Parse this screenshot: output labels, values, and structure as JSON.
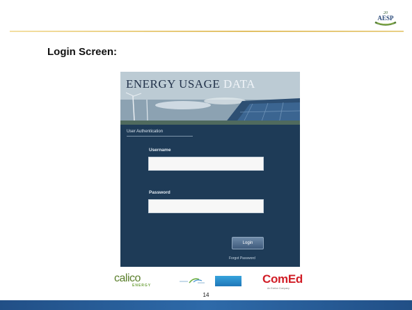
{
  "slide": {
    "title": "Login Screen:",
    "page_number": "14",
    "brand_logo_text": "AESP",
    "brand_logo_icon": "aesp-logo-icon"
  },
  "login_panel": {
    "banner": {
      "title_main": "ENERGY USAGE ",
      "title_accent": "DATA"
    },
    "section_label": "User Authentication",
    "username": {
      "label": "Username",
      "value": ""
    },
    "password": {
      "label": "Password",
      "value": ""
    },
    "login_button_label": "Login",
    "forgot_password_label": "Forgot Password"
  },
  "footer_logos": {
    "calico": {
      "name": "calico",
      "sub": "ENERGY"
    },
    "comed": {
      "name": "ComEd",
      "sub": "An Exelon Company"
    }
  },
  "colors": {
    "panel_bg": "#1e3b57",
    "footer_bar": "#2e6aa9",
    "comed_red": "#d11d26",
    "accent_rule": "#e2c064"
  }
}
